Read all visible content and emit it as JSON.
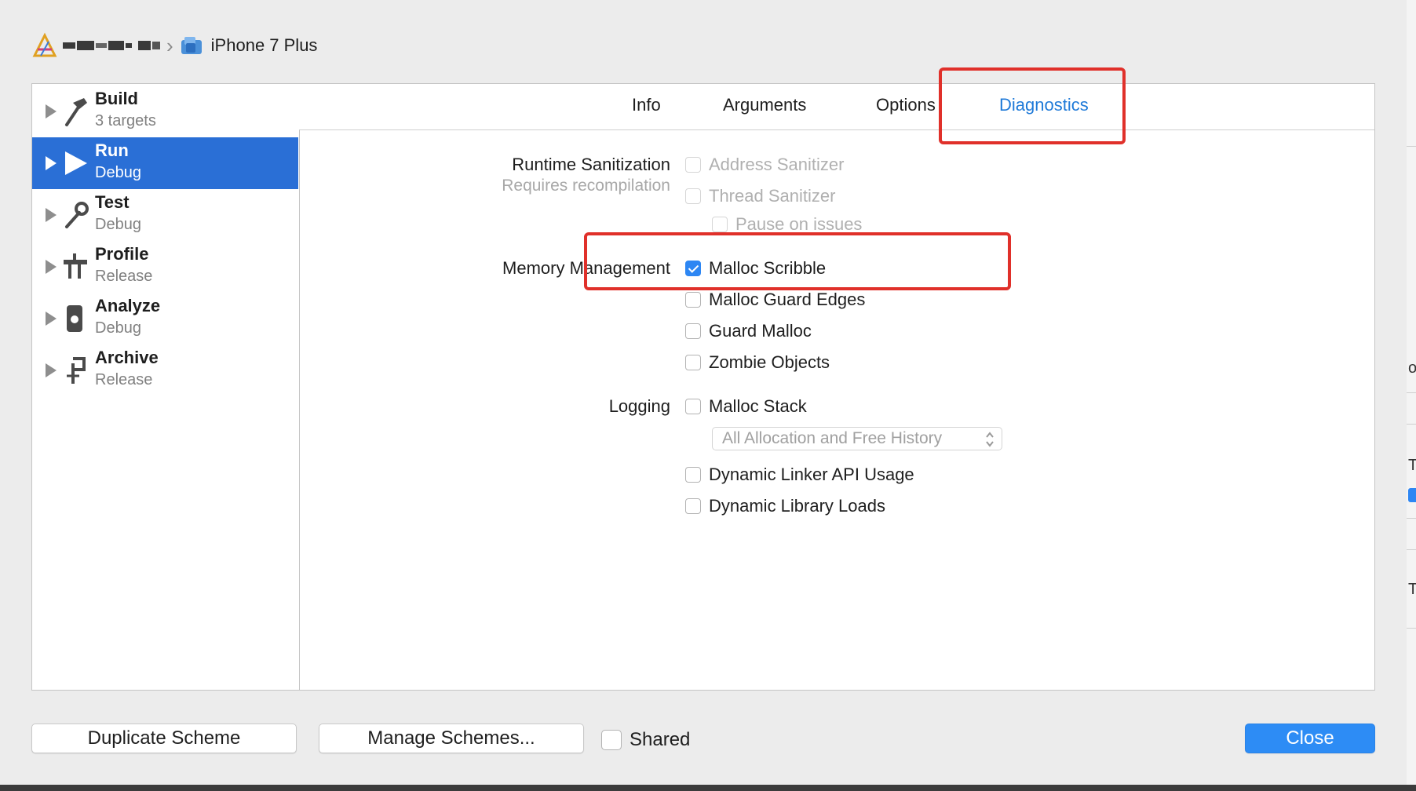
{
  "breadcrumb": {
    "device_label": "iPhone 7 Plus"
  },
  "sidebar": {
    "actions": [
      {
        "name": "Build",
        "sub": "3 targets"
      },
      {
        "name": "Run",
        "sub": "Debug"
      },
      {
        "name": "Test",
        "sub": "Debug"
      },
      {
        "name": "Profile",
        "sub": "Release"
      },
      {
        "name": "Analyze",
        "sub": "Debug"
      },
      {
        "name": "Archive",
        "sub": "Release"
      }
    ],
    "selected": "Run"
  },
  "tabs": [
    {
      "label": "Info"
    },
    {
      "label": "Arguments"
    },
    {
      "label": "Options"
    },
    {
      "label": "Diagnostics"
    }
  ],
  "active_tab": "Diagnostics",
  "diagnostics": {
    "runtime_sanitization": {
      "label": "Runtime Sanitization",
      "sublabel": "Requires recompilation",
      "options": [
        {
          "label": "Address Sanitizer",
          "checked": false,
          "enabled": false
        },
        {
          "label": "Thread Sanitizer",
          "checked": false,
          "enabled": false
        },
        {
          "label": "Pause on issues",
          "checked": false,
          "enabled": false
        }
      ]
    },
    "memory_management": {
      "label": "Memory Management",
      "options": [
        {
          "label": "Malloc Scribble",
          "checked": true,
          "enabled": true
        },
        {
          "label": "Malloc Guard Edges",
          "checked": false,
          "enabled": true
        },
        {
          "label": "Guard Malloc",
          "checked": false,
          "enabled": true
        },
        {
          "label": "Zombie Objects",
          "checked": false,
          "enabled": true
        }
      ]
    },
    "logging": {
      "label": "Logging",
      "options": [
        {
          "label": "Malloc Stack",
          "checked": false,
          "enabled": true
        },
        {
          "label": "Dynamic Linker API Usage",
          "checked": false,
          "enabled": true
        },
        {
          "label": "Dynamic Library Loads",
          "checked": false,
          "enabled": true
        }
      ],
      "malloc_stack_mode": "All Allocation and Free History"
    }
  },
  "footer": {
    "duplicate_label": "Duplicate Scheme",
    "manage_label": "Manage Schemes...",
    "shared_label": "Shared",
    "shared_checked": false,
    "close_label": "Close"
  },
  "colors": {
    "selection": "#2a6fd6",
    "active_tab": "#1f7ad8",
    "checkbox_checked": "#2d86f3",
    "annotation_red": "#e0302a",
    "primary_button": "#2d8cf5"
  },
  "annotations": [
    "red-box-diagnostics-tab",
    "red-box-memory-management"
  ]
}
